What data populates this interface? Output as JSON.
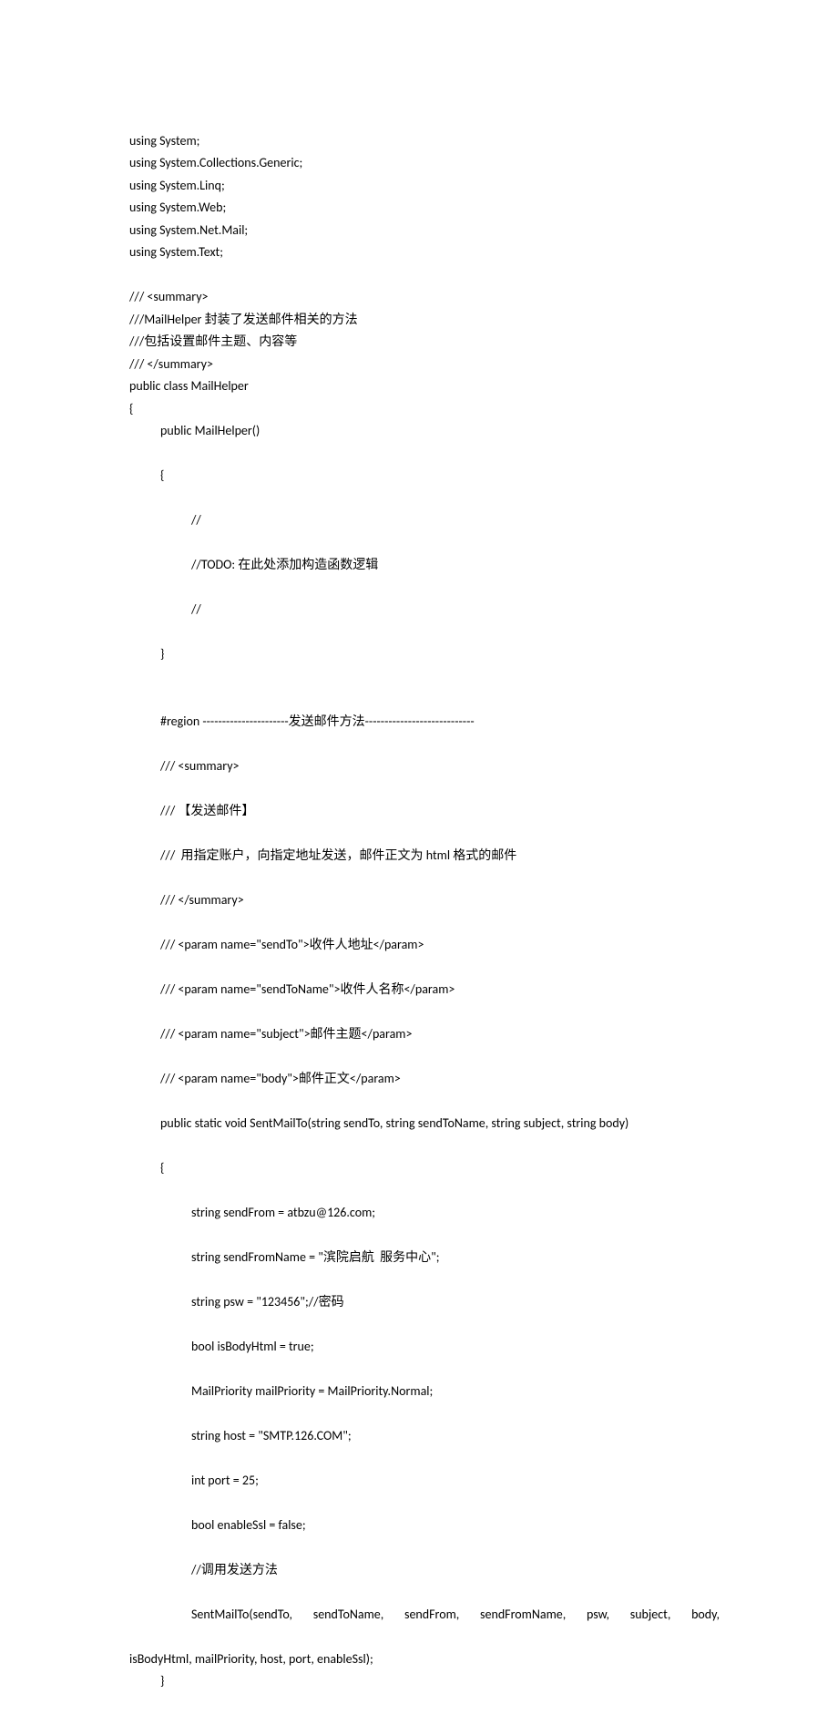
{
  "code": {
    "l01": "using System;",
    "l02": "using System.Collections.Generic;",
    "l03": "using System.Linq;",
    "l04": "using System.Web;",
    "l05": "using System.Net.Mail;",
    "l06": "using System.Text;",
    "l07": "",
    "l08": "/// <summary>",
    "l09": "///MailHelper 封装了发送邮件相关的方法",
    "l10": "///包括设置邮件主题、内容等",
    "l11": "/// </summary>",
    "l12": "public class MailHelper",
    "l13": "{",
    "l14": "public MailHelper()",
    "l15": "{",
    "l16": "//",
    "l17": "//TODO: 在此处添加构造函数逻辑",
    "l18": "//",
    "l19": "}",
    "l20": "",
    "l21": "#region ----------------------发送邮件方法----------------------------",
    "l22": "/// <summary>",
    "l23": "/// 【发送邮件】",
    "l24": "///  用指定账户，向指定地址发送，邮件正文为 html 格式的邮件",
    "l25": "/// </summary>",
    "l26": "/// <param name=\"sendTo\">收件人地址</param>",
    "l27": "/// <param name=\"sendToName\">收件人名称</param>",
    "l28": "/// <param name=\"subject\">邮件主题</param>",
    "l29": "/// <param name=\"body\">邮件正文</param>",
    "l30": "public static void SentMailTo(string sendTo, string sendToName, string subject, string body)",
    "l31": "{",
    "l32": "string sendFrom = atbzu@126.com;",
    "l33": "string sendFromName = \"滨院启航  服务中心\";",
    "l34": "string psw = \"123456\";//密码",
    "l35": "bool isBodyHtml = true;",
    "l36": "MailPriority mailPriority = MailPriority.Normal;",
    "l37": "string host = \"SMTP.126.COM\";",
    "l38": "int port = 25;",
    "l39": "bool enableSsl = false;",
    "l40": "//调用发送方法",
    "l41a": "SentMailTo(sendTo, sendToName, sendFrom, sendFromName, psw, subject, body,",
    "l41b": "isBodyHtml, mailPriority, host, port, enableSsl);",
    "l42": "}"
  }
}
